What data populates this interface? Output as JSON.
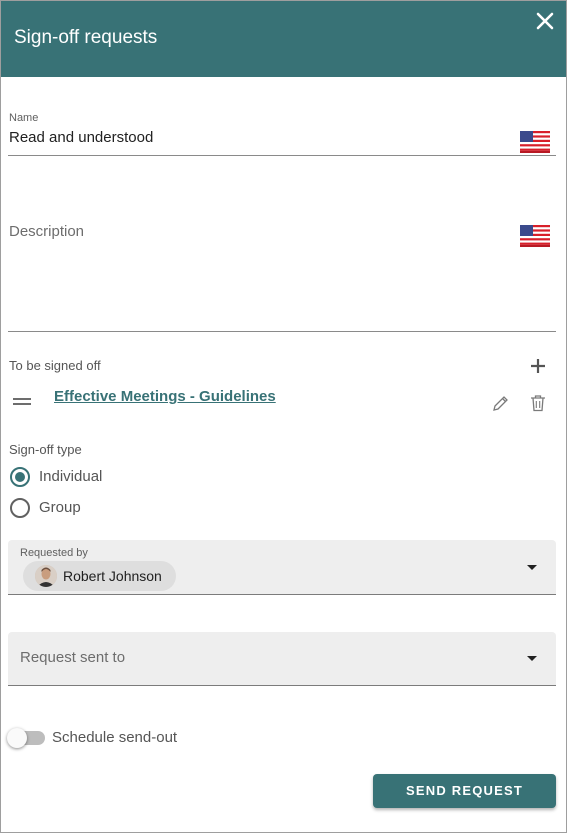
{
  "header": {
    "title": "Sign-off requests",
    "close_icon": "close-icon",
    "color": "#387276"
  },
  "name_field": {
    "label": "Name",
    "value": "Read and understood",
    "language_icon": "us-flag-icon"
  },
  "description_field": {
    "placeholder": "Description",
    "language_icon": "us-flag-icon"
  },
  "to_be_signed": {
    "label": "To be signed off",
    "add_icon": "plus-icon",
    "items": [
      {
        "title": "Effective Meetings - Guidelines",
        "drag_icon": "drag-handle-icon",
        "edit_icon": "pencil-icon",
        "delete_icon": "trash-icon"
      }
    ]
  },
  "signoff_type": {
    "label": "Sign-off type",
    "options": [
      {
        "label": "Individual",
        "selected": true
      },
      {
        "label": "Group",
        "selected": false
      }
    ]
  },
  "requested_by": {
    "label": "Requested by",
    "chip_label": "Robert Johnson"
  },
  "request_sent_to": {
    "placeholder": "Request sent to"
  },
  "schedule": {
    "label": "Schedule send-out",
    "enabled": false
  },
  "actions": {
    "send_label": "SEND REQUEST"
  }
}
